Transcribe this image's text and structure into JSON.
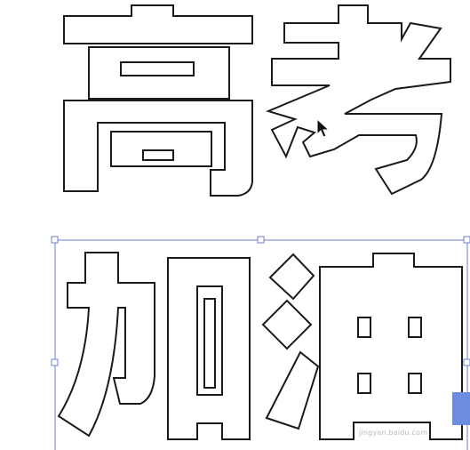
{
  "document": {
    "characters": [
      "高",
      "考",
      "加",
      "油"
    ],
    "watermark": "jingyan.baidu.com"
  },
  "selection": {
    "object": "加油",
    "state": "selected"
  },
  "colors": {
    "outline": "#1a1a1a",
    "fill": "#ffffff",
    "selection": "#6f82c8",
    "edge_tab": "#6b8ce0"
  },
  "icons": {
    "cursor": "arrow-cursor-icon"
  }
}
